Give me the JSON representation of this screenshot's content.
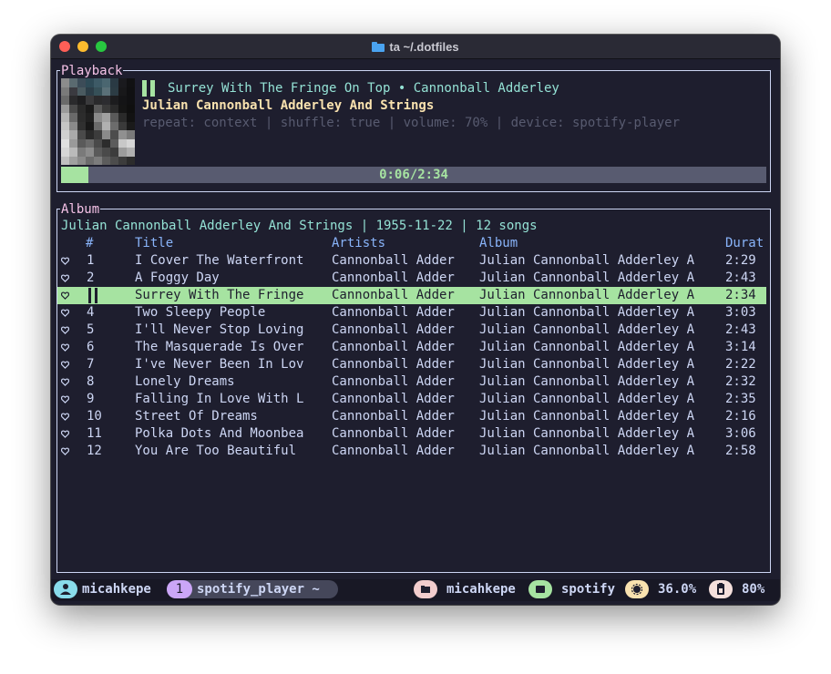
{
  "window": {
    "title": "ta ~/.dotfiles",
    "title_icon": "folder-icon"
  },
  "playback": {
    "label": "Playback",
    "track": "Surrey With The Fringe On Top • Cannonball Adderley",
    "album": "Julian Cannonball Adderley And Strings",
    "meta": "repeat: context | shuffle: true | volume: 70% | device: spotify-player",
    "progress_text": "0:06/2:34",
    "progress_fraction": 0.039,
    "state_icon": "pause-icon"
  },
  "album": {
    "label": "Album",
    "header": "Julian Cannonball Adderley And Strings | 1955-11-22 | 12 songs",
    "columns": {
      "num": "#",
      "title": "Title",
      "artists": "Artists",
      "album": "Album",
      "duration": "Durat"
    },
    "tracks": [
      {
        "num": "1",
        "title": "I Cover The Waterfront",
        "artists": "Cannonball Adder",
        "album": "Julian Cannonball Adderley A",
        "duration": "2:29"
      },
      {
        "num": "2",
        "title": "A Foggy Day",
        "artists": "Cannonball Adder",
        "album": "Julian Cannonball Adderley A",
        "duration": "2:43"
      },
      {
        "num": "",
        "title": "Surrey With The Fringe",
        "artists": "Cannonball Adder",
        "album": "Julian Cannonball Adderley A",
        "duration": "2:34",
        "selected": true
      },
      {
        "num": "4",
        "title": "Two Sleepy People",
        "artists": "Cannonball Adder",
        "album": "Julian Cannonball Adderley A",
        "duration": "3:03"
      },
      {
        "num": "5",
        "title": "I'll Never Stop Loving",
        "artists": "Cannonball Adder",
        "album": "Julian Cannonball Adderley A",
        "duration": "2:43"
      },
      {
        "num": "6",
        "title": "The Masquerade Is Over",
        "artists": "Cannonball Adder",
        "album": "Julian Cannonball Adderley A",
        "duration": "3:14"
      },
      {
        "num": "7",
        "title": "I've Never Been In Lov",
        "artists": "Cannonball Adder",
        "album": "Julian Cannonball Adderley A",
        "duration": "2:22"
      },
      {
        "num": "8",
        "title": "Lonely Dreams",
        "artists": "Cannonball Adder",
        "album": "Julian Cannonball Adderley A",
        "duration": "2:32"
      },
      {
        "num": "9",
        "title": "Falling In Love With L",
        "artists": "Cannonball Adder",
        "album": "Julian Cannonball Adderley A",
        "duration": "2:35"
      },
      {
        "num": "10",
        "title": "Street Of Dreams",
        "artists": "Cannonball Adder",
        "album": "Julian Cannonball Adderley A",
        "duration": "2:16"
      },
      {
        "num": "11",
        "title": "Polka Dots And Moonbea",
        "artists": "Cannonball Adder",
        "album": "Julian Cannonball Adderley A",
        "duration": "3:06"
      },
      {
        "num": "12",
        "title": "You Are Too Beautiful",
        "artists": "Cannonball Adder",
        "album": "Julian Cannonball Adderley A",
        "duration": "2:58"
      }
    ]
  },
  "statusbar": {
    "user": "micahkepe",
    "window_index": "1",
    "window_name": "spotify_player ~",
    "session_user": "micahkepe",
    "session_name": "spotify",
    "cpu": "36.0%",
    "battery": "80%"
  },
  "colors": {
    "bg": "#1e1e2e",
    "green": "#a6e3a1",
    "pink": "#f5c2e7",
    "teal": "#94e2d5",
    "blue": "#89b4fa",
    "peach": "#fab387",
    "yellow": "#f9e2af",
    "text": "#cdd6f4",
    "muted": "#585b70"
  }
}
